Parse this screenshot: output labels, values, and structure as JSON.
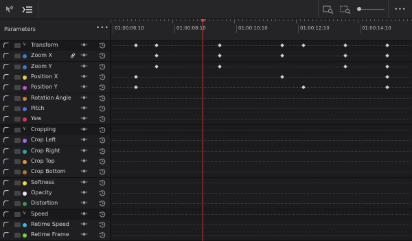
{
  "toolbar": {
    "left_icons": [
      "keyframe-select-icon",
      "parameters-list-icon"
    ],
    "right_icons": [
      "zoom-to-fit-icon",
      "zoom-selection-icon"
    ],
    "more_label": "•••"
  },
  "parameters": {
    "title": "Parameters",
    "more_label": "•••",
    "nav_label": "‹◆›",
    "rows": [
      {
        "label": "Transform",
        "type": "group",
        "expanded": true,
        "color": null
      },
      {
        "label": "Zoom X",
        "type": "param",
        "color": "#3a7bd5",
        "linked": true
      },
      {
        "label": "Zoom Y",
        "type": "param",
        "color": "#3a7bd5"
      },
      {
        "label": "Position X",
        "type": "param",
        "color": "#e0d13a"
      },
      {
        "label": "Position Y",
        "type": "param",
        "color": "#c94fd1"
      },
      {
        "label": "Rotation Angle",
        "type": "param",
        "color": "#e07a2e"
      },
      {
        "label": "Pitch",
        "type": "param",
        "color": "#4a72d8"
      },
      {
        "label": "Yaw",
        "type": "param",
        "color": "#e0335c"
      },
      {
        "label": "Cropping",
        "type": "group",
        "expanded": true,
        "color": null
      },
      {
        "label": "Crop Left",
        "type": "param",
        "color": "#a56be0"
      },
      {
        "label": "Crop Right",
        "type": "param",
        "color": "#2aa8a0"
      },
      {
        "label": "Crop Top",
        "type": "param",
        "color": "#e0962e"
      },
      {
        "label": "Crop Bottom",
        "type": "param",
        "color": "#b07a32"
      },
      {
        "label": "Softness",
        "type": "param",
        "color": "#e8e03a"
      },
      {
        "label": "Opacity",
        "type": "param",
        "color": "#e8e8e8"
      },
      {
        "label": "Distortion",
        "type": "param",
        "color": "#3a9a4a"
      },
      {
        "label": "Speed",
        "type": "group",
        "expanded": true,
        "color": null
      },
      {
        "label": "Retime Speed",
        "type": "param",
        "color": "#3ab8e0"
      },
      {
        "label": "Retime Frame",
        "type": "param",
        "color": "#6ed83a"
      }
    ]
  },
  "timeline": {
    "timecodes": [
      "01:00:06:10",
      "01:00:08:10",
      "01:00:10:10",
      "01:00:12:10",
      "01:00:14:10"
    ],
    "playhead_timecode": "01:00:08:10",
    "keyframes_by_row": [
      [
        1,
        2,
        5,
        8,
        9,
        11,
        13
      ],
      [
        2,
        5,
        8,
        11,
        13
      ],
      [
        2,
        5,
        11,
        13
      ],
      [
        1,
        8,
        13
      ],
      [
        1,
        9,
        13
      ],
      [],
      [],
      [],
      [],
      [],
      [],
      [],
      [],
      [],
      [],
      [],
      [],
      [],
      []
    ],
    "keyframe_slot_count": 14
  }
}
